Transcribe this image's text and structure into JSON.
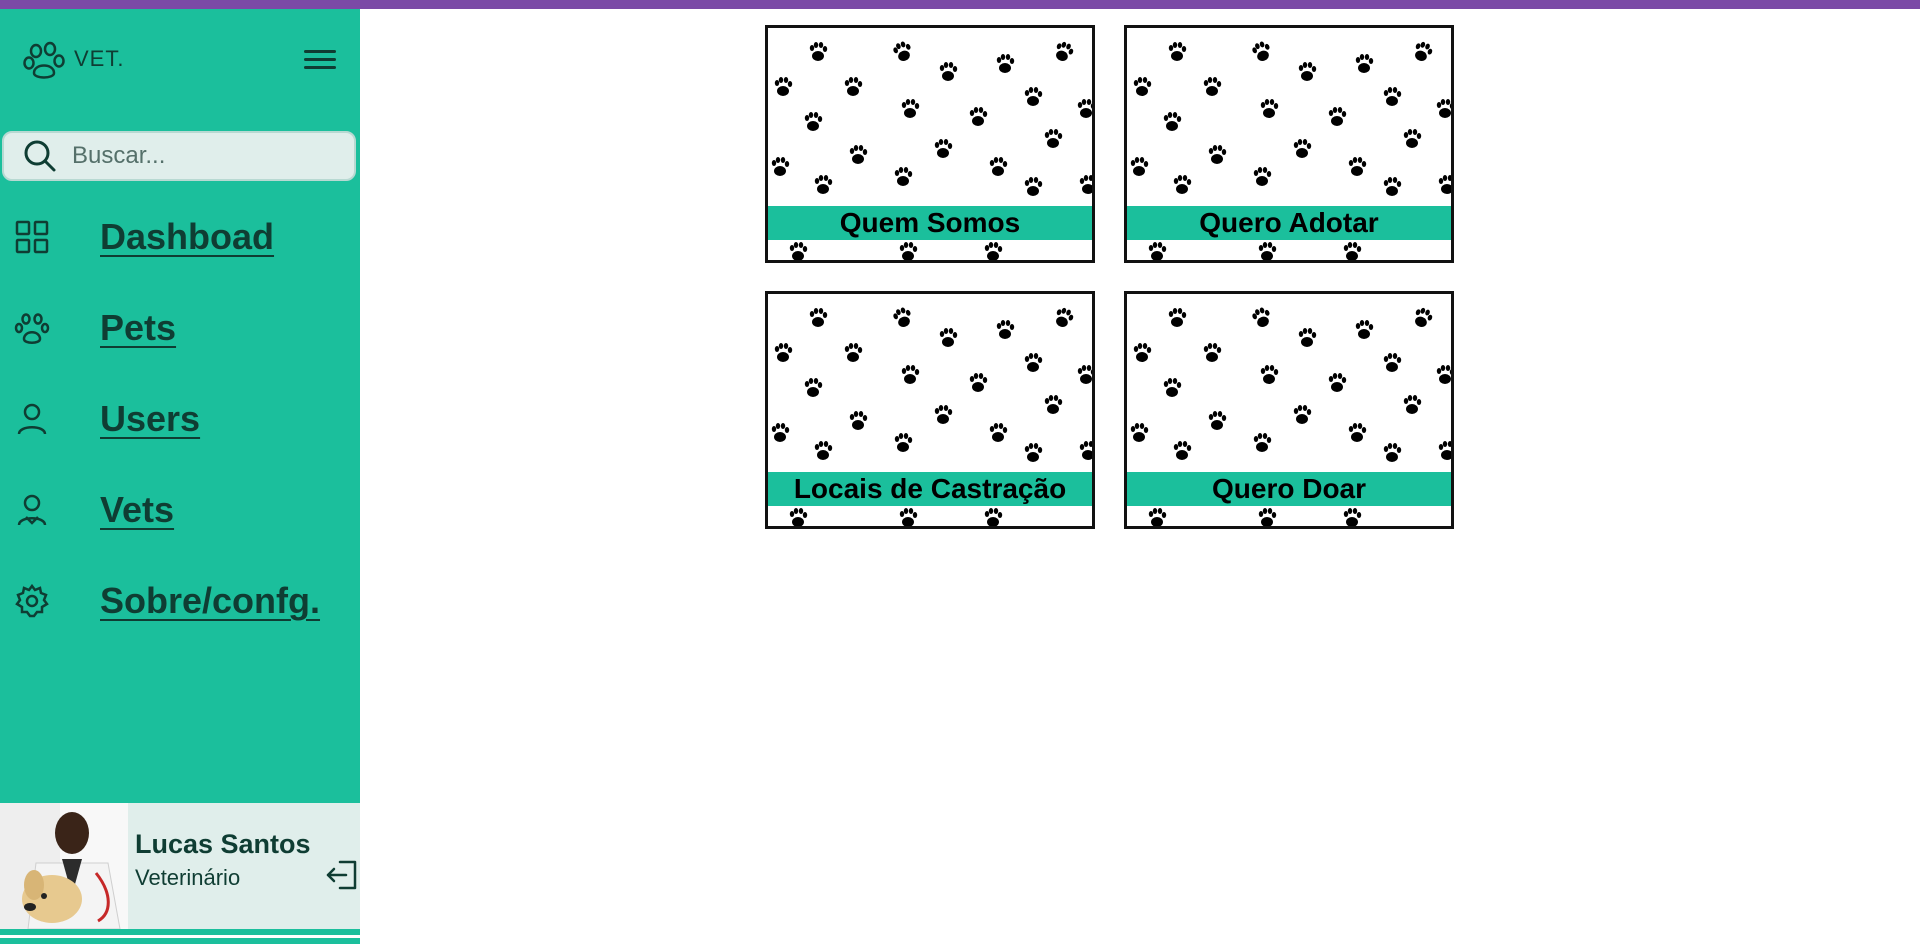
{
  "brand": {
    "name": "VET."
  },
  "search": {
    "placeholder": "Buscar..."
  },
  "nav": [
    {
      "label": "Dashboad",
      "icon": "grid-icon"
    },
    {
      "label": "Pets",
      "icon": "paw-icon"
    },
    {
      "label": "Users",
      "icon": "user-icon"
    },
    {
      "label": "Vets",
      "icon": "vet-icon"
    },
    {
      "label": "Sobre/confg.",
      "icon": "gear-icon"
    }
  ],
  "profile": {
    "name": "Lucas Santos",
    "role": "Veterinário"
  },
  "cards": [
    {
      "label": "Quem Somos"
    },
    {
      "label": "Quero Adotar"
    },
    {
      "label": "Locais de Castração"
    },
    {
      "label": "Quero Doar"
    }
  ],
  "colors": {
    "accent": "#1bbf9c",
    "topbar": "#7b4aa6",
    "dark": "#0f3d33",
    "profile_bg": "#e0eeeb"
  }
}
